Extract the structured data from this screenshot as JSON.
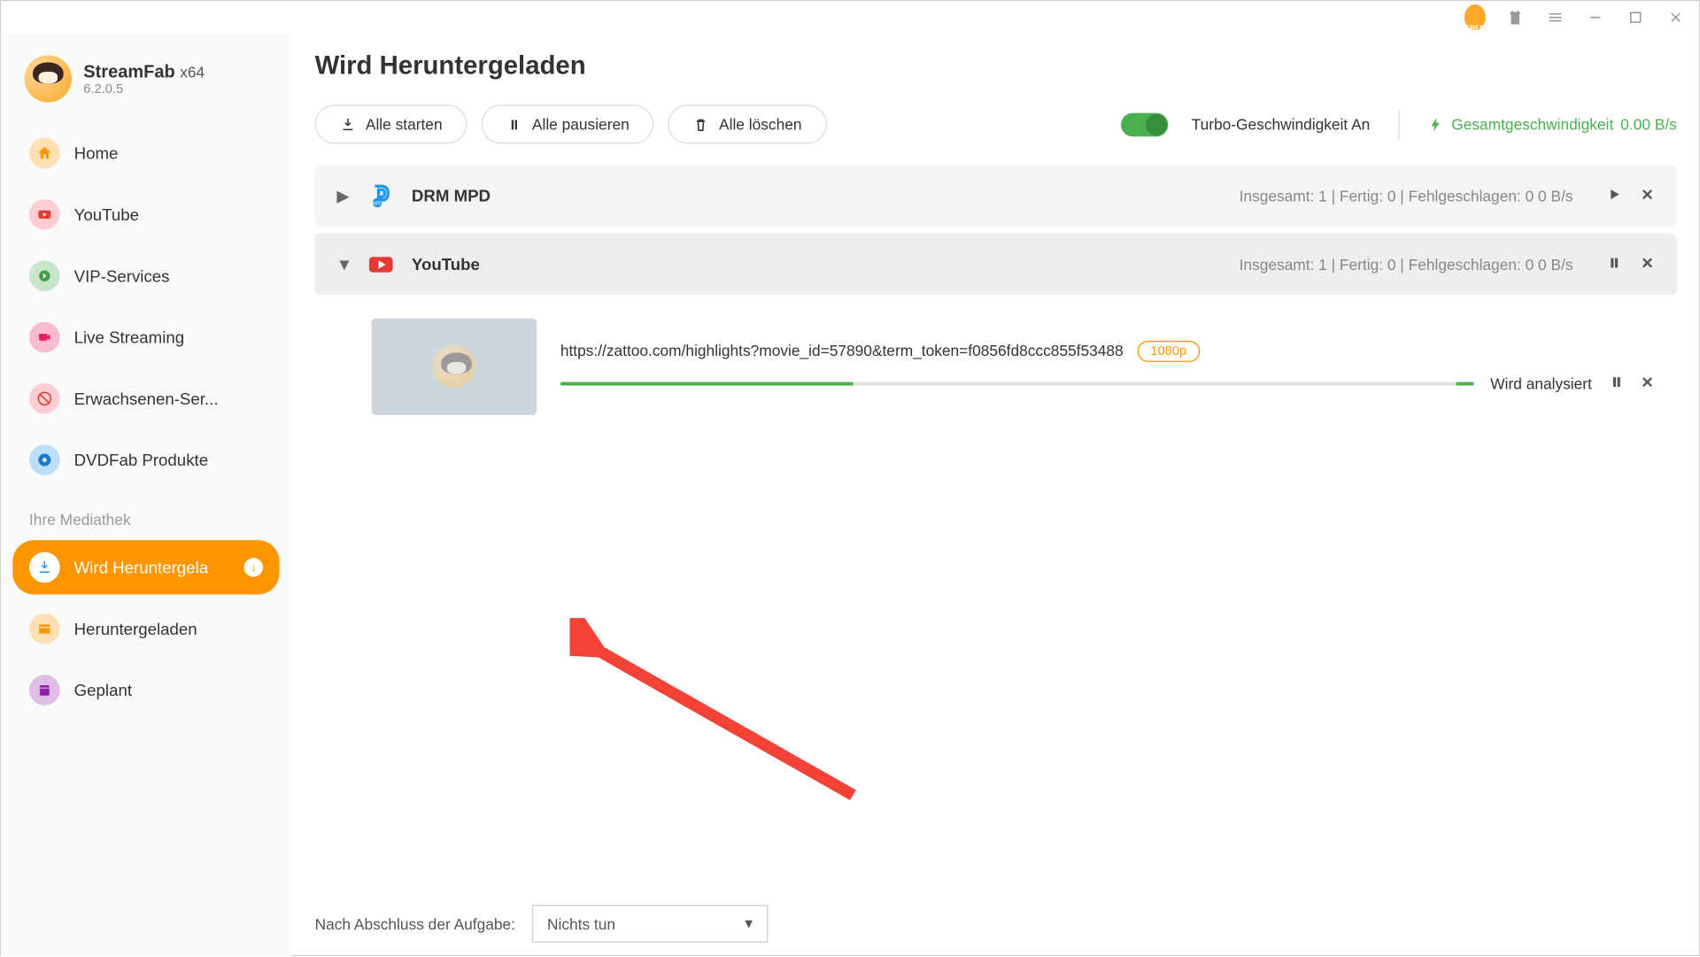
{
  "app": {
    "brand": "StreamFab",
    "arch": "x64",
    "version": "6.2.0.5"
  },
  "sidebar": {
    "items": [
      {
        "label": "Home"
      },
      {
        "label": "YouTube"
      },
      {
        "label": "VIP-Services"
      },
      {
        "label": "Live Streaming"
      },
      {
        "label": "Erwachsenen-Ser..."
      },
      {
        "label": "DVDFab Produkte"
      }
    ],
    "library_header": "Ihre Mediathek",
    "library": [
      {
        "label": "Wird Heruntergela"
      },
      {
        "label": "Heruntergeladen"
      },
      {
        "label": "Geplant"
      }
    ]
  },
  "page": {
    "title": "Wird Heruntergeladen",
    "toolbar": {
      "start_all": "Alle starten",
      "pause_all": "Alle pausieren",
      "delete_all": "Alle löschen",
      "turbo": "Turbo-Geschwindigkeit An",
      "total_speed_label": "Gesamtgeschwindigkeit",
      "total_speed_value": "0.00 B/s"
    }
  },
  "groups": [
    {
      "name": "DRM MPD",
      "stats": "Insgesamt: 1 | Fertig: 0 | Fehlgeschlagen: 0   0 B/s"
    },
    {
      "name": "YouTube",
      "stats": "Insgesamt: 1 | Fertig: 0 | Fehlgeschlagen: 0   0 B/s",
      "items": [
        {
          "url": "https://zattoo.com/highlights?movie_id=57890&term_token=f0856fd8ccc855f53488",
          "quality": "1080p",
          "status": "Wird analysiert"
        }
      ]
    }
  ],
  "footer": {
    "after_task_label": "Nach Abschluss der Aufgabe:",
    "after_task_value": "Nichts tun"
  }
}
